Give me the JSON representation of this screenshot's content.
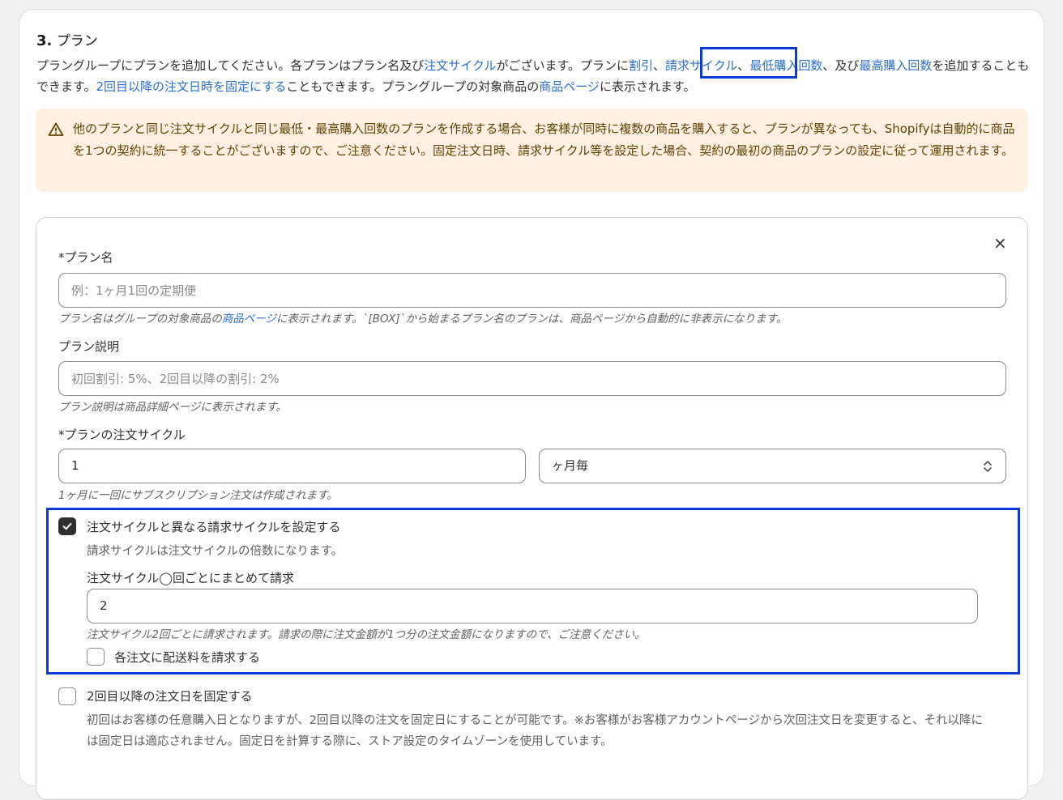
{
  "section": {
    "number": "3.",
    "title": "プラン"
  },
  "description": {
    "t1": "プラングループにプランを追加してください。各プランはプラン名及び",
    "link_order_cycle": "注文サイクル",
    "t2": "がございます。プランに",
    "link_discount": "割引",
    "sep1": "、",
    "link_billing_cycle": "請求サイクル",
    "sep2": "、",
    "link_min_purchase": "最低購入回数",
    "t3": "、及び",
    "link_max_purchase": "最高購入回数",
    "t4": "を追加することもできます。",
    "link_fixed_date": "2回目以降の注文日時を固定にする",
    "t5": "こともできます。プラングループの対象商品の",
    "link_product_page": "商品ページ",
    "t6": "に表示されます。"
  },
  "warning": {
    "text": "他のプランと同じ注文サイクルと同じ最低・最高購入回数のプランを作成する場合、お客様が同時に複数の商品を購入すると、プランが異なっても、Shopifyは自動的に商品を1つの契約に統一することがございますので、ご注意ください。固定注文日時、請求サイクル等を設定した場合、契約の最初の商品のプランの設定に従って運用されます。"
  },
  "plan_form": {
    "close_icon": "×",
    "plan_name": {
      "label": "*プラン名",
      "placeholder": "例：1ヶ月1回の定期便",
      "help_1": "プラン名はグループの対象商品の",
      "help_link": "商品ページ",
      "help_2": "に表示されます。`[BOX]`から始まるプラン名のプランは、商品ページから自動的に非表示になります。"
    },
    "plan_description": {
      "label": "プラン説明",
      "placeholder": "初回割引: 5%、2回目以降の割引: 2%",
      "help": "プラン説明は商品詳細ページに表示されます。"
    },
    "order_cycle": {
      "label": "*プランの注文サイクル",
      "value": "1",
      "unit": "ヶ月毎",
      "help": "1ヶ月に一回にサブスクリプション注文は作成されます。"
    },
    "billing_cycle": {
      "checkbox_label": "注文サイクルと異なる請求サイクルを設定する",
      "checked": true,
      "note": "請求サイクルは注文サイクルの倍数になります。",
      "field_label": "注文サイクル◯回ごとにまとめて請求",
      "value": "2",
      "help": "注文サイクル2回ごとに請求されます。請求の際に注文金額が1つ分の注文金額になりますので、ご注意ください。",
      "shipping_label": "各注文に配送料を請求する",
      "shipping_checked": false
    },
    "fixed_date": {
      "checkbox_label": "2回目以降の注文日を固定する",
      "checked": false,
      "note": "初回はお客様の任意購入日となりますが、2回目以降の注文を固定日にすることが可能です。※お客様がお客様アカウントページから次回注文日を変更すると、それ以降には固定日は適応されません。固定日を計算する際に、ストア設定のタイムゾーンを使用しています。"
    }
  },
  "colors": {
    "link": "#2c6ecb",
    "highlight": "#0b3ad6",
    "warning_bg": "#fff0e2"
  }
}
